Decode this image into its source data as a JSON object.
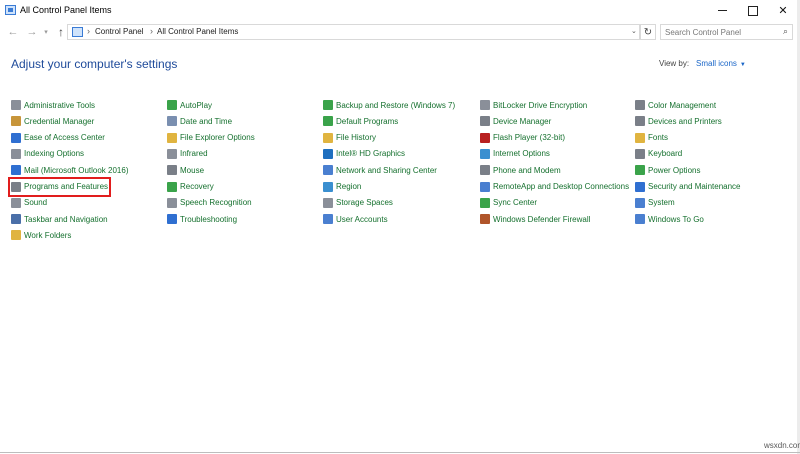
{
  "window": {
    "title": "All Control Panel Items",
    "controls": {
      "minimize": "",
      "maximize": "",
      "close": "✕"
    }
  },
  "nav": {
    "back": "←",
    "forward": "→",
    "recent": "▾",
    "up": "↑",
    "breadcrumbs": [
      "Control Panel",
      "All Control Panel Items"
    ],
    "separator": "›",
    "dropdown": "⌄",
    "refresh": "↻",
    "search_placeholder": "Search Control Panel",
    "search_icon": "⌕"
  },
  "main": {
    "heading": "Adjust your computer's settings",
    "view_by_label": "View by:",
    "view_by_value": "Small icons",
    "view_by_caret": "▼"
  },
  "columns": [
    [
      {
        "label": "Administrative Tools",
        "icon": "admin-tools-icon",
        "color": "#8a8f99"
      },
      {
        "label": "Credential Manager",
        "icon": "credential-manager-icon",
        "color": "#c7953a"
      },
      {
        "label": "Ease of Access Center",
        "icon": "ease-of-access-icon",
        "color": "#2f6fd1"
      },
      {
        "label": "Indexing Options",
        "icon": "indexing-options-icon",
        "color": "#8a8f99"
      },
      {
        "label": "Mail (Microsoft Outlook 2016)",
        "icon": "mail-icon",
        "color": "#2f6fd1"
      },
      {
        "label": "Programs and Features",
        "icon": "programs-features-icon",
        "color": "#7a7f88"
      },
      {
        "label": "Sound",
        "icon": "sound-icon",
        "color": "#8a8f99"
      },
      {
        "label": "Taskbar and Navigation",
        "icon": "taskbar-icon",
        "color": "#4a6fa8"
      },
      {
        "label": "Work Folders",
        "icon": "work-folders-icon",
        "color": "#e0b440"
      }
    ],
    [
      {
        "label": "AutoPlay",
        "icon": "autoplay-icon",
        "color": "#3aa34a"
      },
      {
        "label": "Date and Time",
        "icon": "date-time-icon",
        "color": "#7a8fb0"
      },
      {
        "label": "File Explorer Options",
        "icon": "file-explorer-options-icon",
        "color": "#e0b440"
      },
      {
        "label": "Infrared",
        "icon": "infrared-icon",
        "color": "#8a8f99"
      },
      {
        "label": "Mouse",
        "icon": "mouse-icon",
        "color": "#7a7f88"
      },
      {
        "label": "Recovery",
        "icon": "recovery-icon",
        "color": "#3aa34a"
      },
      {
        "label": "Speech Recognition",
        "icon": "speech-recognition-icon",
        "color": "#8a8f99"
      },
      {
        "label": "Troubleshooting",
        "icon": "troubleshooting-icon",
        "color": "#2f6fd1"
      }
    ],
    [
      {
        "label": "Backup and Restore (Windows 7)",
        "icon": "backup-restore-icon",
        "color": "#3aa34a"
      },
      {
        "label": "Default Programs",
        "icon": "default-programs-icon",
        "color": "#3aa34a"
      },
      {
        "label": "File History",
        "icon": "file-history-icon",
        "color": "#e0b440"
      },
      {
        "label": "Intel® HD Graphics",
        "icon": "intel-graphics-icon",
        "color": "#1e6fbf"
      },
      {
        "label": "Network and Sharing Center",
        "icon": "network-sharing-icon",
        "color": "#4a7fd0"
      },
      {
        "label": "Region",
        "icon": "region-icon",
        "color": "#3a8fd0"
      },
      {
        "label": "Storage Spaces",
        "icon": "storage-spaces-icon",
        "color": "#8a8f99"
      },
      {
        "label": "User Accounts",
        "icon": "user-accounts-icon",
        "color": "#4a7fd0"
      }
    ],
    [
      {
        "label": "BitLocker Drive Encryption",
        "icon": "bitlocker-icon",
        "color": "#8a8f99"
      },
      {
        "label": "Device Manager",
        "icon": "device-manager-icon",
        "color": "#7a7f88"
      },
      {
        "label": "Flash Player (32-bit)",
        "icon": "flash-player-icon",
        "color": "#b82020"
      },
      {
        "label": "Internet Options",
        "icon": "internet-options-icon",
        "color": "#3a8fd0"
      },
      {
        "label": "Phone and Modem",
        "icon": "phone-modem-icon",
        "color": "#7a7f88"
      },
      {
        "label": "RemoteApp and Desktop Connections",
        "icon": "remoteapp-icon",
        "color": "#4a7fd0"
      },
      {
        "label": "Sync Center",
        "icon": "sync-center-icon",
        "color": "#3aa34a"
      },
      {
        "label": "Windows Defender Firewall",
        "icon": "firewall-icon",
        "color": "#b0552a"
      }
    ],
    [
      {
        "label": "Color Management",
        "icon": "color-management-icon",
        "color": "#7a7f88"
      },
      {
        "label": "Devices and Printers",
        "icon": "devices-printers-icon",
        "color": "#7a7f88"
      },
      {
        "label": "Fonts",
        "icon": "fonts-icon",
        "color": "#e0b440"
      },
      {
        "label": "Keyboard",
        "icon": "keyboard-icon",
        "color": "#7a7f88"
      },
      {
        "label": "Power Options",
        "icon": "power-options-icon",
        "color": "#3aa34a"
      },
      {
        "label": "Security and Maintenance",
        "icon": "security-maintenance-icon",
        "color": "#2f6fd1"
      },
      {
        "label": "System",
        "icon": "system-icon",
        "color": "#4a7fd0"
      },
      {
        "label": "Windows To Go",
        "icon": "windows-to-go-icon",
        "color": "#4a7fd0"
      }
    ]
  ],
  "highlighted_item": "Programs and Features",
  "watermark": "wsxdn.com",
  "colors": {
    "link": "#15702e",
    "heading": "#1e4a9a",
    "accent": "#1a66c8",
    "highlight_border": "#e11d1d"
  }
}
